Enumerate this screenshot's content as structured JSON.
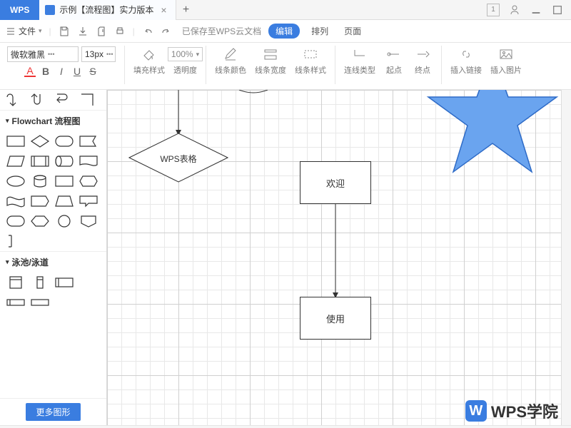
{
  "brand": "WPS",
  "tab": {
    "title": "示例【流程图】实力版本"
  },
  "file_menu": "文件",
  "cloud_status": "已保存至WPS云文档",
  "menus": {
    "edit": "编辑",
    "arrange": "排列",
    "page": "页面"
  },
  "font": {
    "family": "微软雅黑",
    "size": "13px"
  },
  "format": {
    "bold": "B",
    "italic": "I",
    "underline": "U",
    "strike": "S",
    "color": "A"
  },
  "zoom": "100%",
  "tool": {
    "fill": "填充样式",
    "opacity": "透明度",
    "lineColor": "线条颜色",
    "lineWidth": "线条宽度",
    "lineStyle": "线条样式",
    "connType": "连线类型",
    "start": "起点",
    "end": "终点",
    "link": "插入链接",
    "image": "插入图片"
  },
  "sidebar": {
    "flowchart": "Flowchart 流程图",
    "swimlane": "泳池/泳道",
    "more": "更多图形"
  },
  "canvas": {
    "decision": "WPS表格",
    "box1": "欢迎",
    "box2": "使用"
  },
  "watermark": "WPS学院"
}
